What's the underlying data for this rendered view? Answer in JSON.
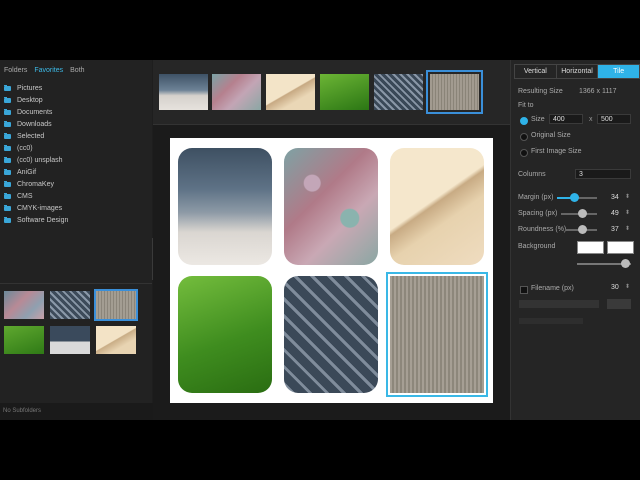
{
  "left_tabs": [
    "Folders",
    "Favorites",
    "Both"
  ],
  "folders": [
    "Pictures",
    "Desktop",
    "Documents",
    "Downloads",
    "Selected",
    "(cc0)",
    "(cc0) unsplash",
    "AniGif",
    "ChromaKey",
    "CMS",
    "CMYK-images",
    "Software Design"
  ],
  "left_status": "No Subfolders",
  "layout_tabs": [
    "Vertical",
    "Horizontal",
    "Tile"
  ],
  "resulting_size_label": "Resulting Size",
  "resulting_size_value": "1366 x 1117",
  "fit_to_label": "Fit to",
  "size_label": "Size",
  "size_w": "400",
  "size_x": "x",
  "size_h": "500",
  "original_size_label": "Original Size",
  "first_image_size_label": "First Image Size",
  "columns_label": "Columns",
  "columns_value": "3",
  "margin_label": "Margin (px)",
  "margin_value": "34",
  "spacing_label": "Spacing (px)",
  "spacing_value": "49",
  "roundness_label": "Roundness (%)",
  "roundness_value": "37",
  "background_label": "Background",
  "filename_label": "Filename (px)",
  "filename_value": "30",
  "colors": {
    "accent": "#2fb3e8",
    "selection": "#3a8fd9"
  }
}
